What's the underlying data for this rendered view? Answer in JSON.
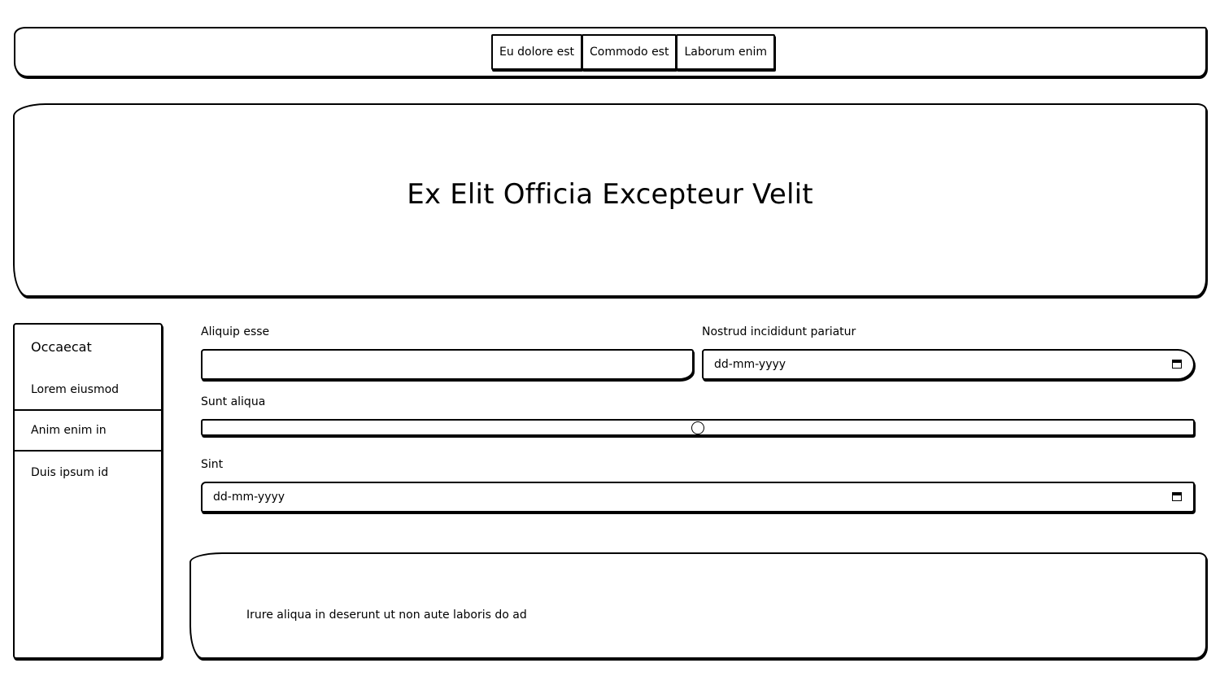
{
  "topnav": {
    "buttons": [
      "Eu dolore est",
      "Commodo est",
      "Laborum enim"
    ]
  },
  "hero": {
    "title": "Ex Elit Officia Excepteur Velit"
  },
  "sidebar": {
    "title": "Occaecat",
    "items": [
      "Lorem eiusmod",
      "Anim enim in",
      "Duis ipsum id"
    ]
  },
  "form": {
    "field1_label": "Aliquip esse",
    "field1_value": "",
    "field2_label": "Nostrud incididunt pariatur",
    "field2_placeholder": "dd-mm-yyyy",
    "slider_label": "Sunt aliqua",
    "slider_value": 0.5,
    "field3_label": "Sint",
    "field3_placeholder": "dd-mm-yyyy"
  },
  "footer": {
    "text": "Irure aliqua in deserunt ut non aute laboris do ad"
  }
}
